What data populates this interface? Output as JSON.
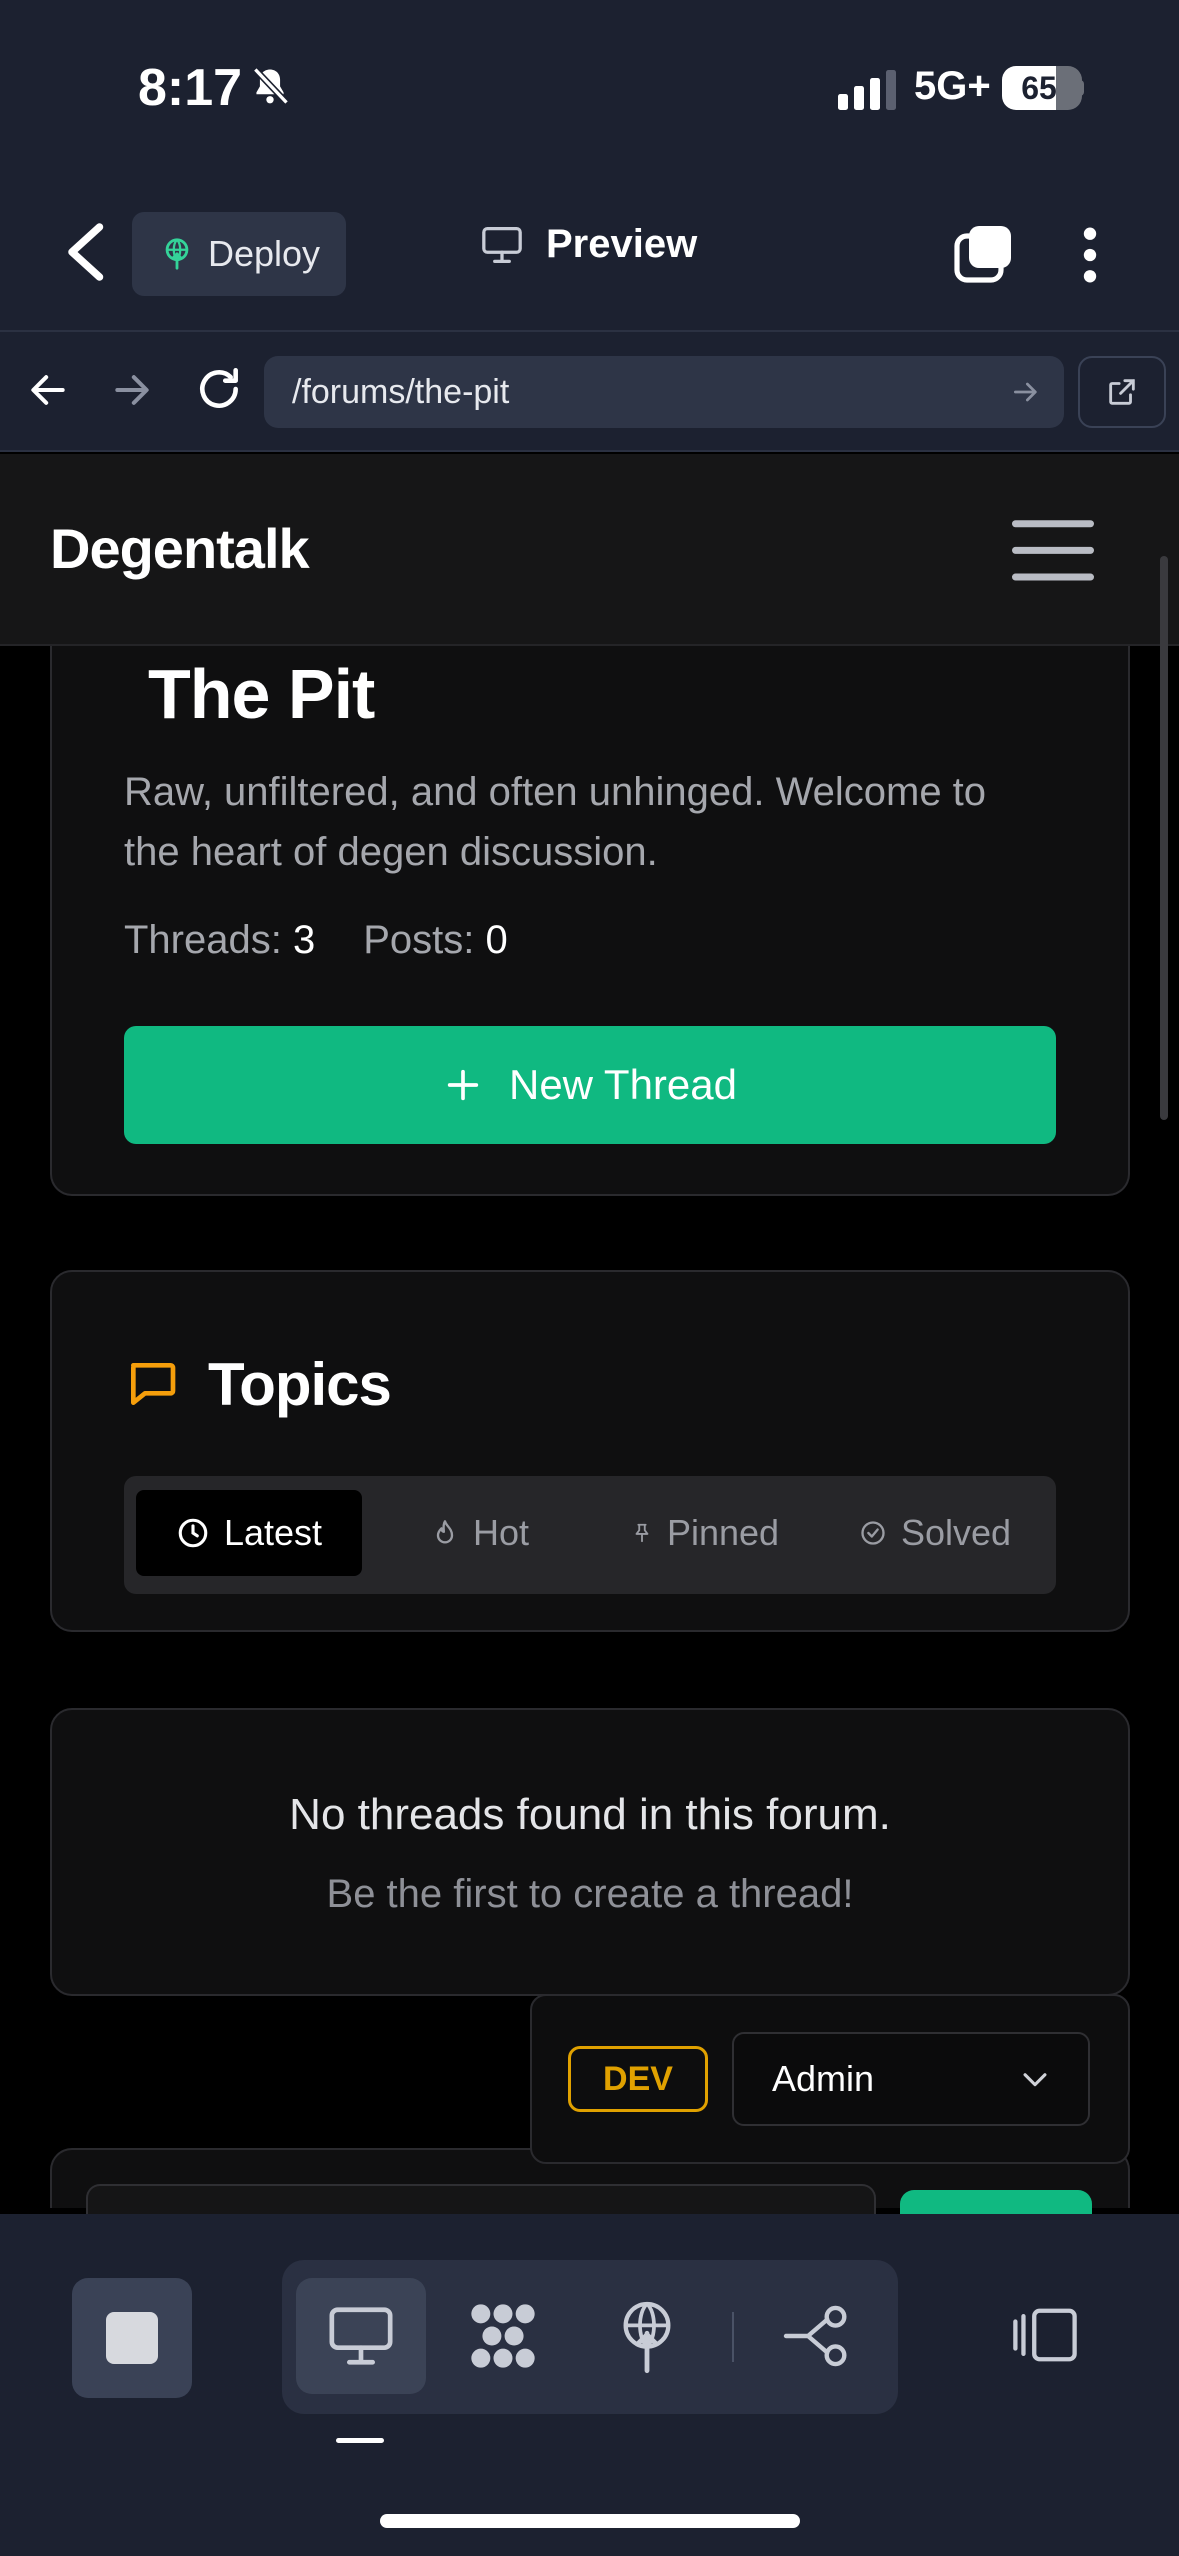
{
  "status_bar": {
    "time": "8:17",
    "network": "5G+",
    "battery": "65",
    "battery_level": 0.65
  },
  "toolbar": {
    "deploy_label": "Deploy",
    "preview_label": "Preview"
  },
  "browser": {
    "url": "/forums/the-pit"
  },
  "site": {
    "logo": "Degentalk"
  },
  "forum": {
    "title": "The Pit",
    "description": "Raw, unfiltered, and often unhinged. Welcome to the heart of degen discussion.",
    "threads_label": "Threads:",
    "threads_count": "3",
    "posts_label": "Posts:",
    "posts_count": "0",
    "new_thread_label": "New Thread"
  },
  "topics": {
    "title": "Topics",
    "tabs": [
      {
        "label": "Latest",
        "icon": "clock-icon",
        "active": true
      },
      {
        "label": "Hot",
        "icon": "flame-icon",
        "active": false
      },
      {
        "label": "Pinned",
        "icon": "pin-icon",
        "active": false
      },
      {
        "label": "Solved",
        "icon": "check-circle-icon",
        "active": false
      }
    ]
  },
  "empty_state": {
    "title": "No threads found in this forum.",
    "subtitle": "Be the first to create a thread!"
  },
  "dev_panel": {
    "badge": "DEV",
    "role_selected": "Admin"
  },
  "colors": {
    "accent": "#10b981",
    "dev": "#e0a100",
    "topics_icon": "#f59e0b",
    "chrome": "#1c2130"
  }
}
